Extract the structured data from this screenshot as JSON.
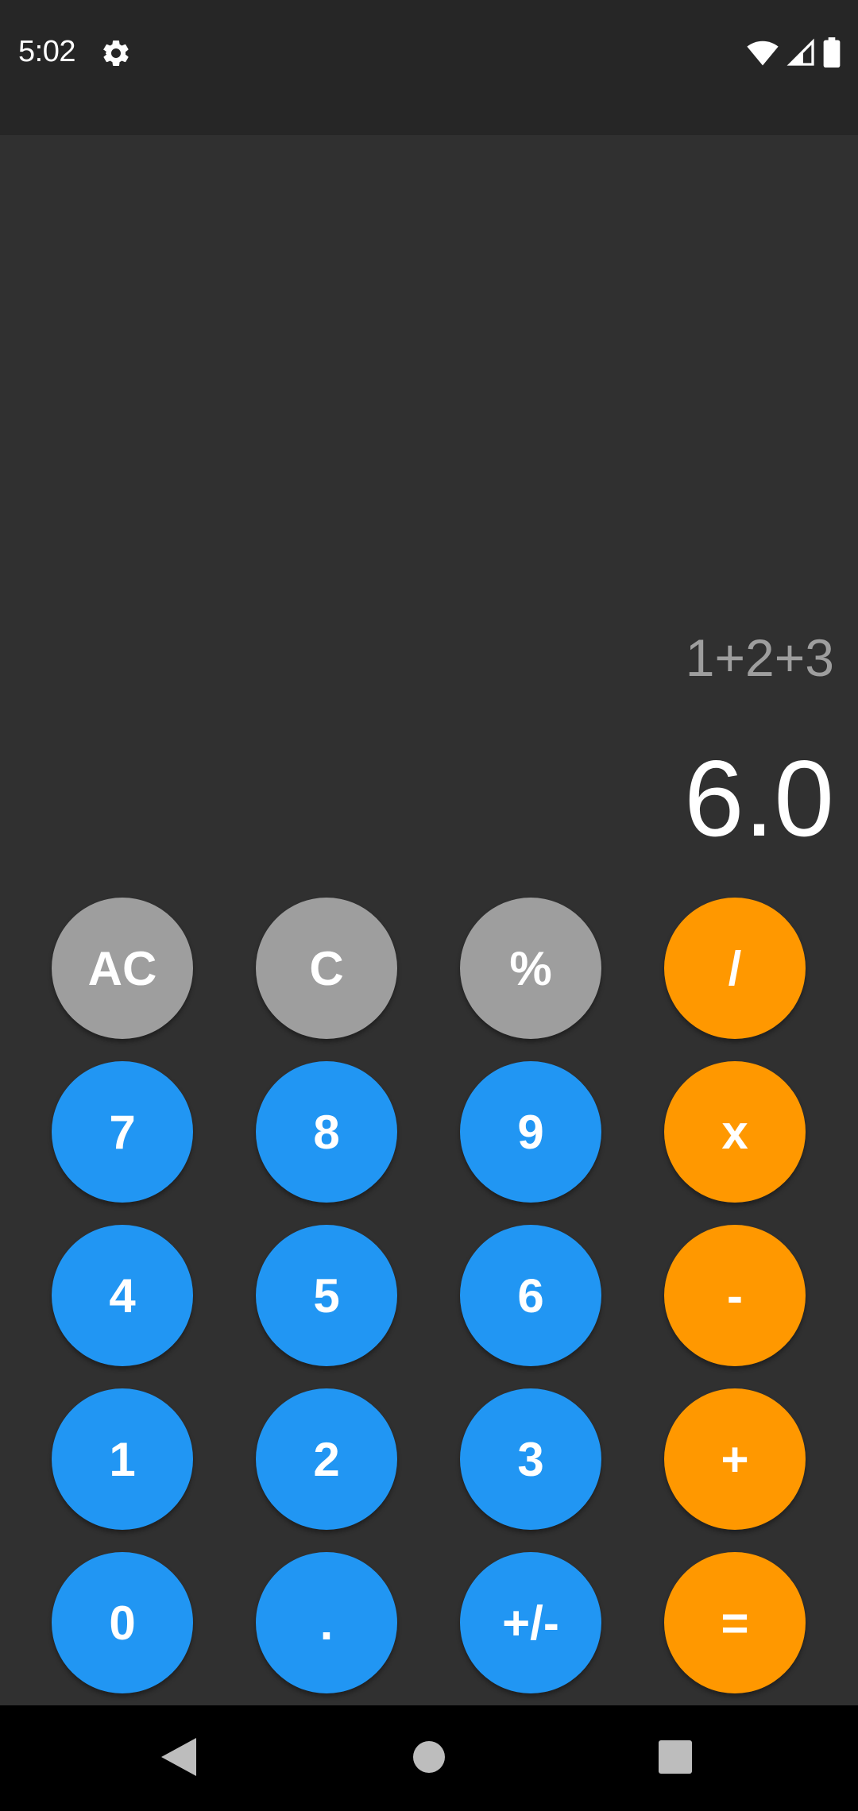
{
  "status_bar": {
    "time": "5:02",
    "icons": [
      "gear-icon",
      "wifi-icon",
      "signal-icon",
      "battery-icon"
    ]
  },
  "display": {
    "expression": "1+2+3",
    "result": "6.0"
  },
  "keypad": {
    "rows": [
      [
        {
          "label": "AC",
          "style": "gray"
        },
        {
          "label": "C",
          "style": "gray"
        },
        {
          "label": "%",
          "style": "gray"
        },
        {
          "label": "/",
          "style": "orange"
        }
      ],
      [
        {
          "label": "7",
          "style": "blue"
        },
        {
          "label": "8",
          "style": "blue"
        },
        {
          "label": "9",
          "style": "blue"
        },
        {
          "label": "x",
          "style": "orange"
        }
      ],
      [
        {
          "label": "4",
          "style": "blue"
        },
        {
          "label": "5",
          "style": "blue"
        },
        {
          "label": "6",
          "style": "blue"
        },
        {
          "label": "-",
          "style": "orange"
        }
      ],
      [
        {
          "label": "1",
          "style": "blue"
        },
        {
          "label": "2",
          "style": "blue"
        },
        {
          "label": "3",
          "style": "blue"
        },
        {
          "label": "+",
          "style": "orange"
        }
      ],
      [
        {
          "label": "0",
          "style": "blue"
        },
        {
          "label": ".",
          "style": "blue"
        },
        {
          "label": "+/-",
          "style": "blue"
        },
        {
          "label": "=",
          "style": "orange"
        }
      ]
    ]
  },
  "colors": {
    "background": "#303030",
    "status_bar": "#262626",
    "function_key": "#9e9e9e",
    "digit_key": "#2196f3",
    "operator_key": "#ff9800",
    "nav_bar": "#000000"
  },
  "nav_bar": {
    "buttons": [
      "back-icon",
      "home-icon",
      "recents-icon"
    ]
  }
}
